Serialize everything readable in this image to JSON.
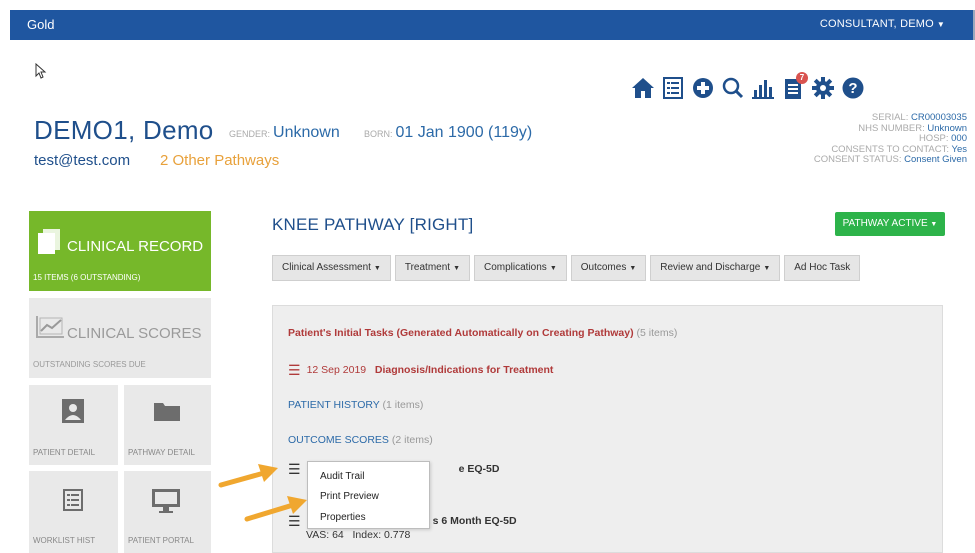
{
  "topbar": {
    "brand": "Gold",
    "user": "CONSULTANT, DEMO",
    "user_caret": "▼"
  },
  "toolbar_icons": [
    "home-icon",
    "list-icon",
    "plus-circle-icon",
    "search-icon",
    "bar-chart-icon",
    "clipboard-icon",
    "gear-icon",
    "question-circle-icon"
  ],
  "notifications_badge": "7",
  "patient": {
    "name": "DEMO1, Demo",
    "gender_label": "GENDER:",
    "gender": "Unknown",
    "born_label": "BORN:",
    "born": "01 Jan 1900 (119y)",
    "email": "test@test.com",
    "other_pathways": "2 Other Pathways"
  },
  "info": {
    "serial_label": "SERIAL:",
    "serial": "CR00003035",
    "nhs_label": "NHS NUMBER:",
    "nhs": "Unknown",
    "hosp_label": "HOSP:",
    "hosp": "000",
    "consent_contact_label": "CONSENTS TO CONTACT:",
    "consent_contact": "Yes",
    "consent_status_label": "CONSENT STATUS:",
    "consent_status": "Consent Given"
  },
  "sidebar": {
    "clinical_record": {
      "title": "CLINICAL RECORD",
      "sub": "15 ITEMS (6 OUTSTANDING)"
    },
    "clinical_scores": {
      "title": "CLINICAL SCORES",
      "sub": "OUTSTANDING SCORES DUE"
    },
    "patient_detail": "PATIENT DETAIL",
    "pathway_detail": "PATHWAY DETAIL",
    "worklist_hist": "WORKLIST HIST",
    "patient_portal": "PATIENT PORTAL"
  },
  "pathway": {
    "title": "KNEE PATHWAY [RIGHT]",
    "status_button": "PATHWAY ACTIVE",
    "tabs": [
      "Clinical Assessment",
      "Treatment",
      "Complications",
      "Outcomes",
      "Review and Discharge",
      "Ad Hoc Task"
    ]
  },
  "panel": {
    "initial_tasks": "Patient's Initial Tasks (Generated Automatically on Creating Pathway)",
    "initial_tasks_count": "(5 items)",
    "diagnosis_date": "12 Sep 2019",
    "diagnosis": "Diagnosis/Indications for Treatment",
    "history": "PATIENT HISTORY",
    "history_count": "(1 items)",
    "outcome_scores": "OUTCOME SCORES",
    "outcome_count": "(2 items)",
    "score1_partial": "e EQ-5D",
    "score2_partial": "s 6 Month EQ-5D",
    "score2_vas": "VAS: 64",
    "score2_index": "Index: 0.778"
  },
  "context_menu": {
    "items": [
      "Audit Trail",
      "Print Preview",
      "Properties"
    ]
  },
  "colors": {
    "topbar": "#1f56a0",
    "green": "#76b82a",
    "pathway_green": "#2db34a",
    "red": "#b03a3a",
    "orange": "#e8a13b"
  }
}
